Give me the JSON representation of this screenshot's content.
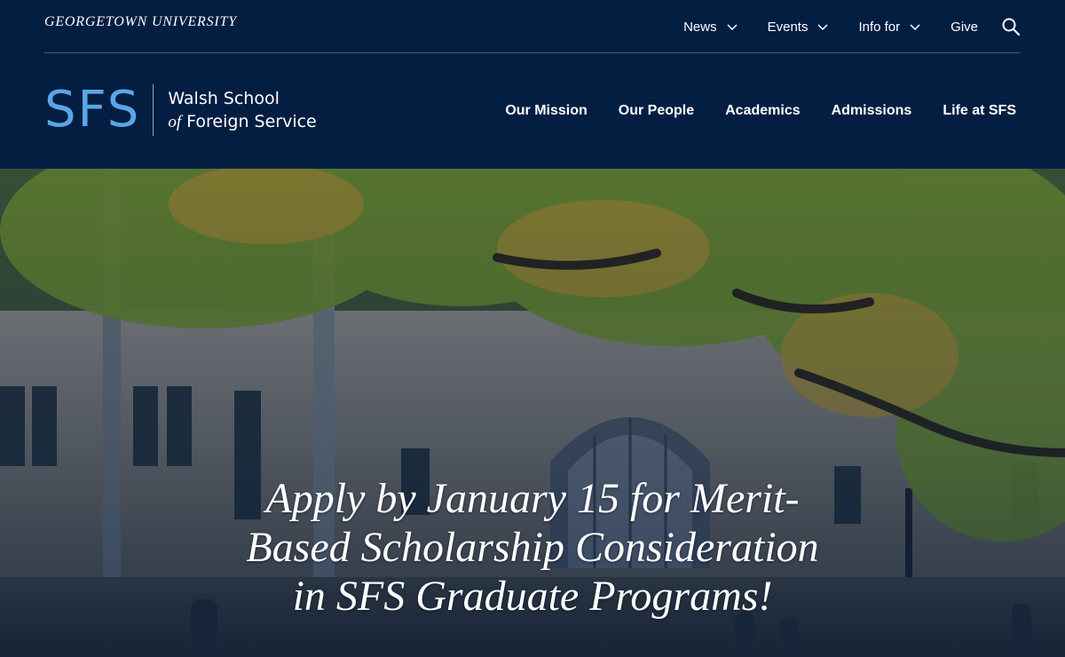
{
  "utility": {
    "wordmark": "GEORGETOWN UNIVERSITY",
    "items": [
      {
        "label": "News",
        "dropdown": true
      },
      {
        "label": "Events",
        "dropdown": true
      },
      {
        "label": "Info for",
        "dropdown": true
      },
      {
        "label": "Give",
        "dropdown": false
      }
    ],
    "search_icon": "search-icon"
  },
  "brand": {
    "letters": "SFS",
    "line1": "Walsh School",
    "line2_italic": "of",
    "line2_rest": " Foreign Service"
  },
  "main_nav": {
    "items": [
      "Our Mission",
      "Our People",
      "Academics",
      "Admissions",
      "Life at SFS"
    ]
  },
  "hero": {
    "headline": "Apply by January 15 for Merit-Based Scholarship Consideration in SFS Graduate Programs!"
  },
  "colors": {
    "navy": "#041e42",
    "sfs_blue": "#5aa6e8",
    "text": "#ffffff"
  }
}
